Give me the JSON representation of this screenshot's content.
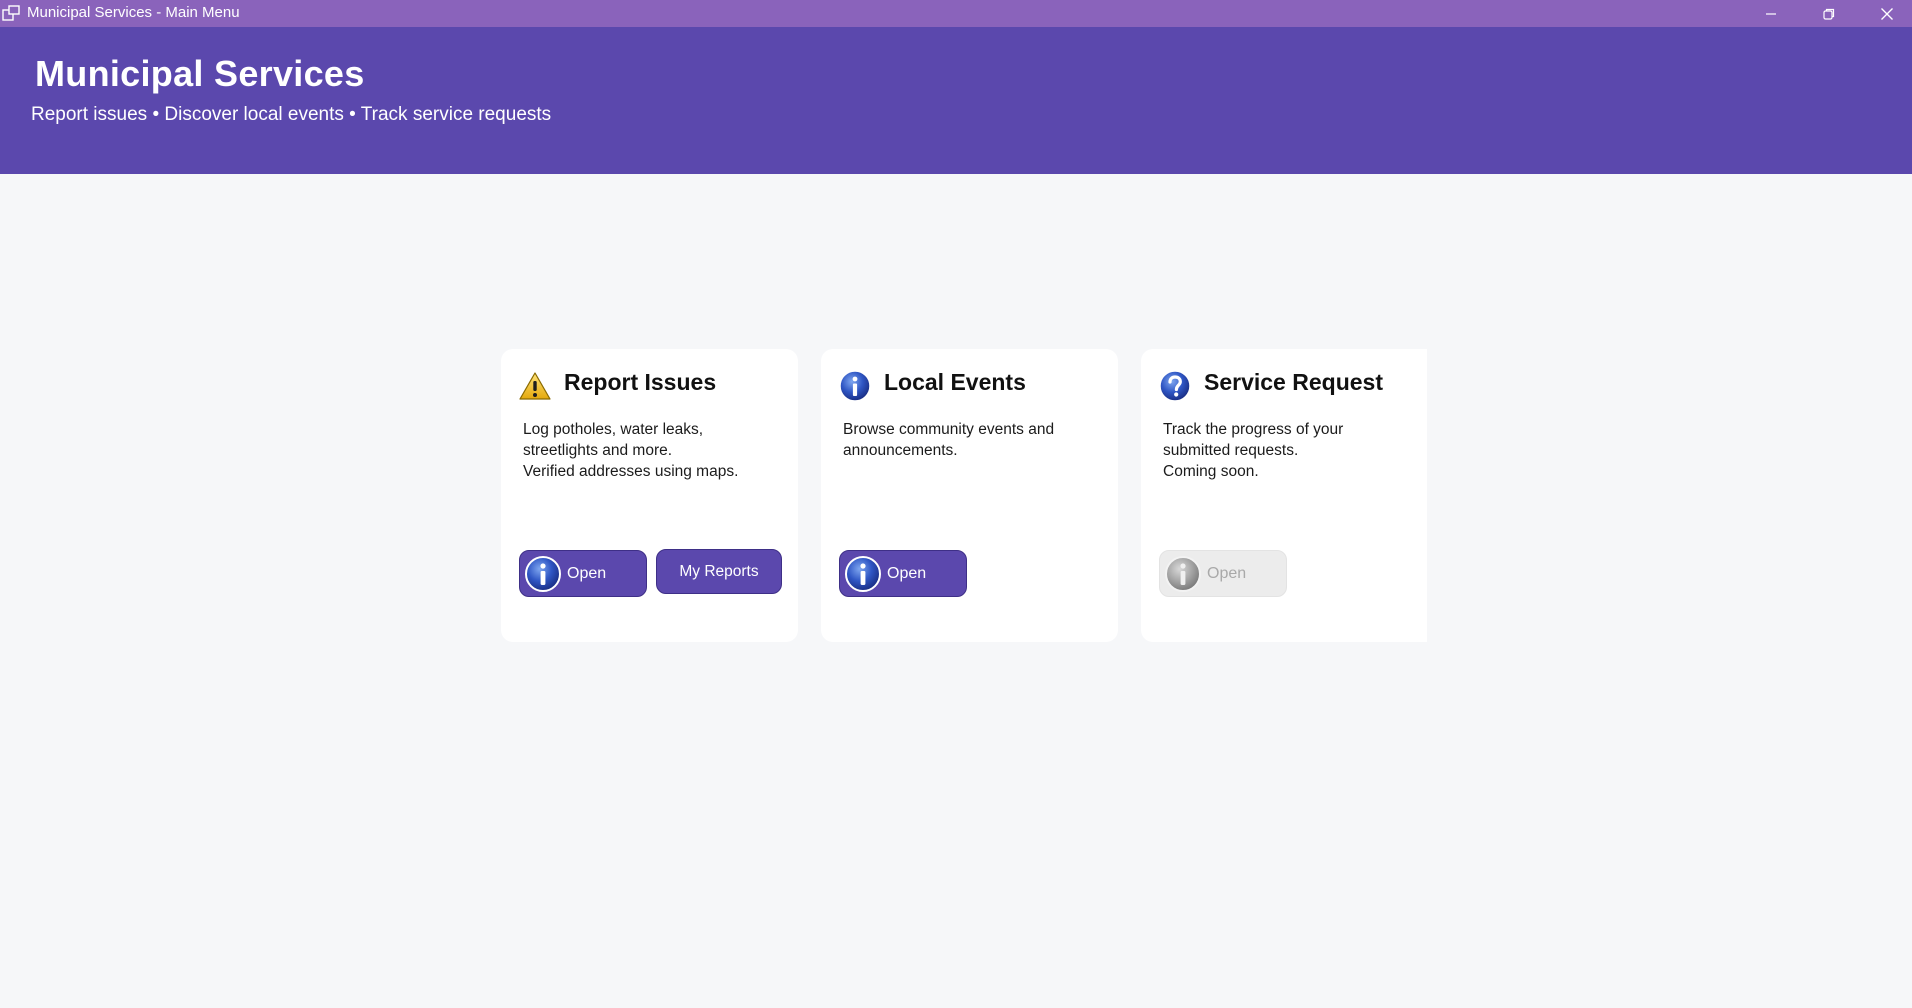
{
  "window": {
    "title": "Municipal Services - Main Menu",
    "controls": {
      "minimize": "minimize-icon",
      "restore": "restore-icon",
      "close": "close-icon"
    }
  },
  "header": {
    "title": "Municipal Services",
    "subtitle": "Report issues • Discover local events • Track service requests"
  },
  "colors": {
    "titlebar": "#8a63bb",
    "header": "#5b48ad",
    "background": "#f6f7f9",
    "card": "#ffffff",
    "button": "#5b48ad",
    "button_disabled": "#ececec"
  },
  "cards": [
    {
      "icon": "warning-icon",
      "title": "Report Issues",
      "description": "Log potholes, water leaks,\nstreetlights and more.\nVerified addresses using maps.",
      "buttons": [
        {
          "label": "Open",
          "icon": "info-icon",
          "enabled": true
        },
        {
          "label": "My Reports",
          "enabled": true
        }
      ]
    },
    {
      "icon": "info-icon",
      "title": "Local Events",
      "description": "Browse community events and\nannouncements.",
      "buttons": [
        {
          "label": "Open",
          "icon": "info-icon",
          "enabled": true
        }
      ]
    },
    {
      "icon": "question-icon",
      "title": "Service Request",
      "description": "Track the progress of your\nsubmitted requests.\nComing soon.",
      "buttons": [
        {
          "label": "Open",
          "icon": "info-icon",
          "enabled": false
        }
      ]
    }
  ]
}
